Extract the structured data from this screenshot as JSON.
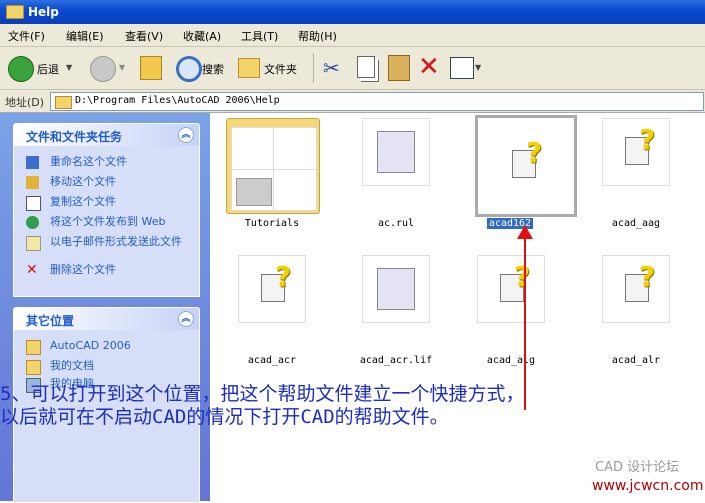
{
  "window": {
    "title": "Help"
  },
  "menu": [
    "文件(F)",
    "编辑(E)",
    "查看(V)",
    "收藏(A)",
    "工具(T)",
    "帮助(H)"
  ],
  "toolbar": {
    "back": "后退",
    "search": "搜索",
    "folders": "文件夹"
  },
  "address": {
    "label": "地址(D)",
    "path": "D:\\Program Files\\AutoCAD 2006\\Help"
  },
  "tasks": {
    "title": "文件和文件夹任务",
    "items": [
      "重命名这个文件",
      "移动这个文件",
      "复制这个文件",
      "将这个文件发布到 Web",
      "以电子邮件形式发送此文件",
      "删除这个文件"
    ]
  },
  "places": {
    "title": "其它位置",
    "items": [
      "AutoCAD 2006",
      "我的文档",
      "我的电脑"
    ]
  },
  "files": [
    {
      "name": "Tutorials"
    },
    {
      "name": "ac.rul"
    },
    {
      "name": "acad162"
    },
    {
      "name": "acad_aag"
    },
    {
      "name": "acad_acr"
    },
    {
      "name": "acad_acr.lif"
    },
    {
      "name": "acad_alg"
    },
    {
      "name": "acad_alr"
    }
  ],
  "caption": {
    "line1": "5、可以打开到这个位置，把这个帮助文件建立一个快捷方式，",
    "line2": "以后就可在不启动CAD的情况下打开CAD的帮助文件。"
  },
  "watermark": {
    "line1": "CAD 设计论坛",
    "line2": "www.jcwcn.com"
  },
  "colors": {
    "titlebar": "#0b4bd0",
    "sidebar": "#6e8ddf",
    "caption": "#1d2dbf",
    "arrow": "#e01010"
  }
}
